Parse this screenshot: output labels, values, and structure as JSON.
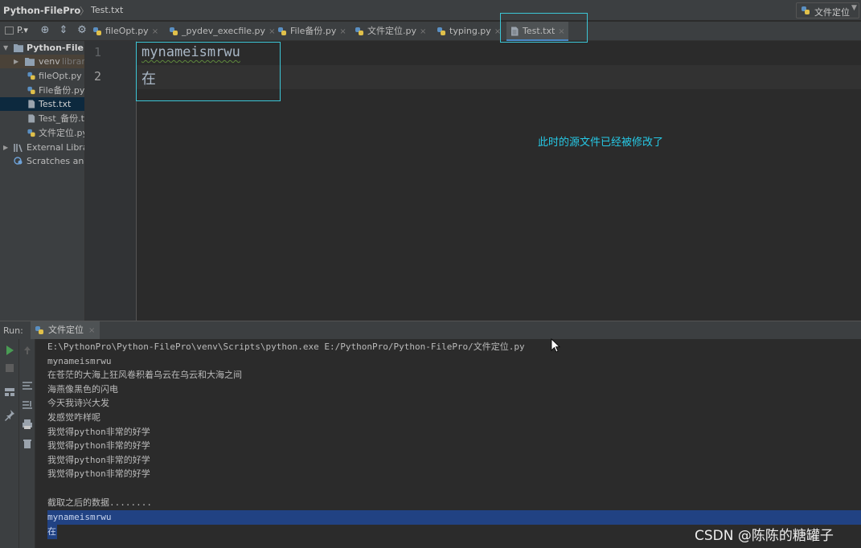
{
  "breadcrumb": {
    "project": "Python-FilePro",
    "separator": "〉",
    "file": "Test.txt"
  },
  "run_config": {
    "label": "文件定位",
    "arrow": "▼"
  },
  "toolbar": {
    "project_dropdown": "P.▾",
    "target_icon": "⊕",
    "collapse_icon": "⇕",
    "settings_icon": "⚙"
  },
  "tabs": [
    {
      "label": "fileOpt.py",
      "close": "×"
    },
    {
      "label": "_pydev_execfile.py",
      "close": "×"
    },
    {
      "label": "File备份.py",
      "close": "×"
    },
    {
      "label": "文件定位.py",
      "close": "×"
    },
    {
      "label": "typing.py",
      "close": "×"
    },
    {
      "label": "Test.txt",
      "close": "×"
    }
  ],
  "sidebar": {
    "root": "Python-FilePro",
    "items": [
      {
        "label": "venv",
        "hint": "library"
      },
      {
        "label": "fileOpt.py"
      },
      {
        "label": "File备份.py"
      },
      {
        "label": "Test.txt"
      },
      {
        "label": "Test_备份.txt"
      },
      {
        "label": "文件定位.py"
      },
      {
        "label": "External Libraries"
      },
      {
        "label": "Scratches and Consoles"
      }
    ]
  },
  "editor": {
    "line_numbers": [
      "1",
      "2"
    ],
    "lines": [
      "mynameismrwu",
      "在"
    ],
    "annotation": "此时的源文件已经被修改了"
  },
  "run": {
    "title": "Run:",
    "tab_label": "文件定位",
    "tab_close": "×",
    "command": "E:\\PythonPro\\Python-FilePro\\venv\\Scripts\\python.exe E:/PythonPro/Python-FilePro/文件定位.py",
    "output": [
      "mynameismrwu",
      "在苍茫的大海上狂风卷积着乌云在乌云和大海之间",
      "海燕像黑色的闪电",
      "今天我诗兴大发",
      "发感觉咋样呢",
      "我觉得python非常的好学",
      "我觉得python非常的好学",
      "我觉得python非常的好学",
      "我觉得python非常的好学",
      "",
      "截取之后的数据........",
      "mynameismrwu",
      "在"
    ]
  },
  "colors": {
    "accent": "#4a88c7",
    "annotation": "#26c9e6",
    "highlight_box": "#3cc6d6",
    "selection": "#214283"
  },
  "watermark": "CSDN @陈陈的糖罐子"
}
